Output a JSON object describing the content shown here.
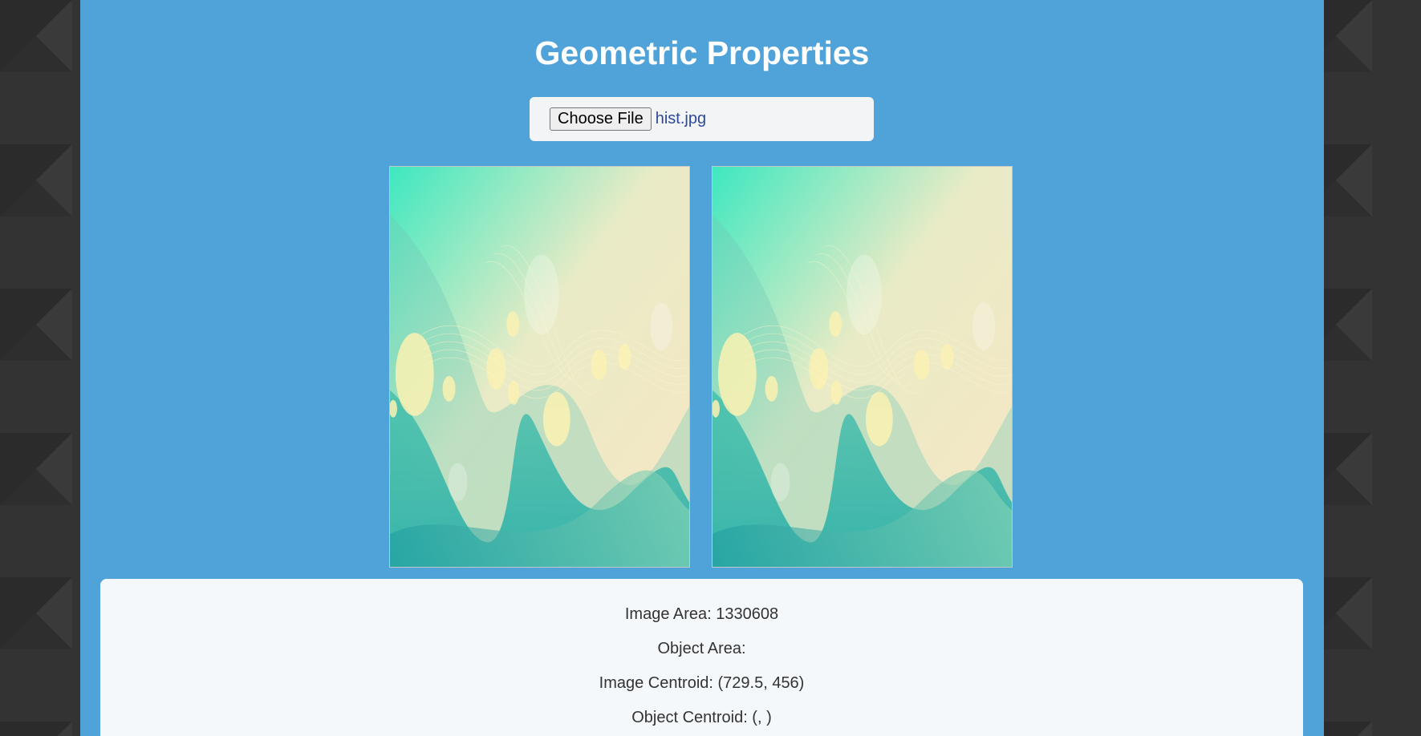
{
  "page": {
    "title": "Geometric Properties"
  },
  "file_input": {
    "button_label": "Choose File",
    "file_name": "hist.jpg"
  },
  "images": [
    {
      "name": "original-image",
      "icon": "abstract-teal-yellow-bokeh-image"
    },
    {
      "name": "processed-image",
      "icon": "abstract-teal-yellow-bokeh-image"
    }
  ],
  "results": {
    "image_area": "Image Area: 1330608",
    "object_area": "Object Area:",
    "image_centroid": "Image Centroid: (729.5, 456)",
    "object_centroid": "Object Centroid: (, )"
  },
  "colors": {
    "background": "#333333",
    "panel": "#50a3d9",
    "card": "#f4f8fb",
    "title_text": "#ffffff",
    "file_name_text": "#2d4a9a"
  }
}
